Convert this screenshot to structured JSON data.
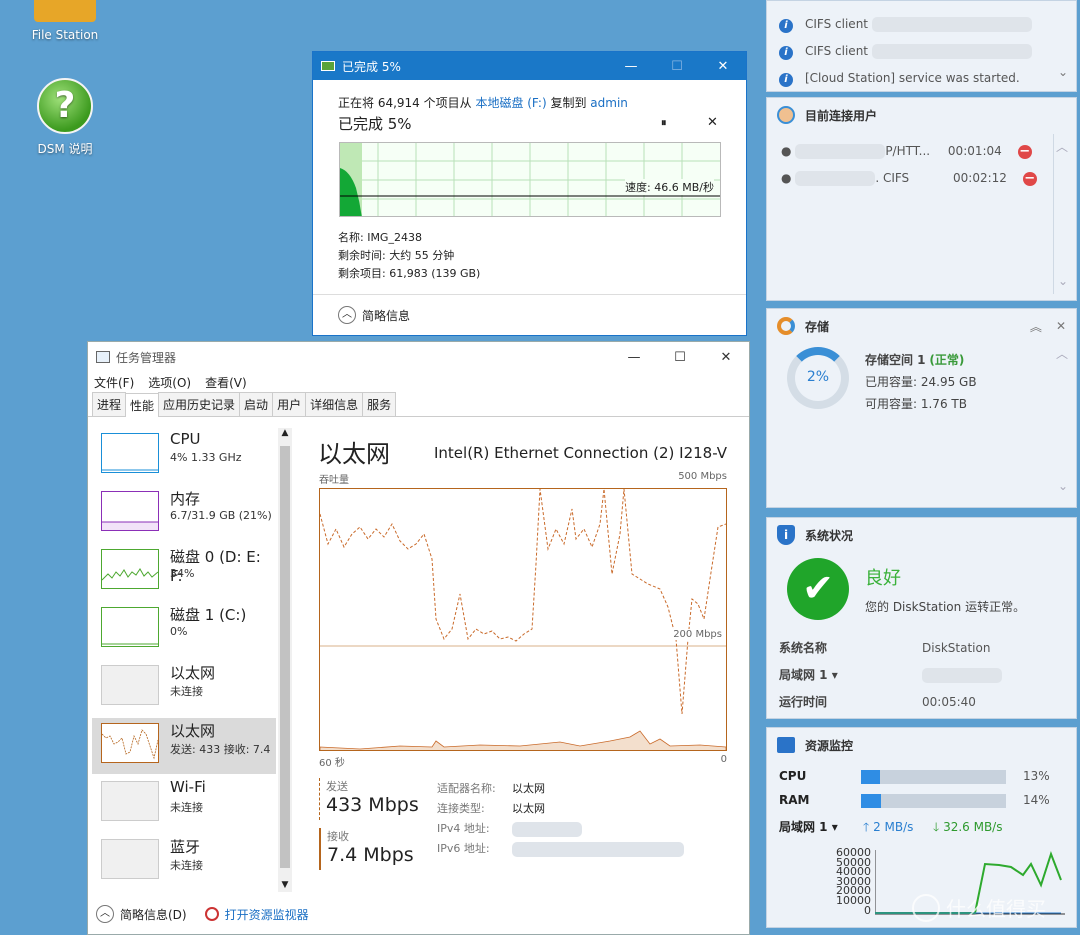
{
  "desktop": {
    "file_station": "File Station",
    "dsm_help": "DSM 说明"
  },
  "copy_dialog": {
    "title": "已完成 5%",
    "line1_prefix": "正在将 64,914 个项目从 ",
    "source": "本地磁盘 (F:)",
    "line1_mid": " 复制到 ",
    "dest": "admin",
    "progress": "已完成 5%",
    "pause": "⏸",
    "close": "✕",
    "speed": "速度: 46.6 MB/秒",
    "name": "名称: IMG_2438",
    "time_left": "剩余时间: 大约 55 分钟",
    "items_left": "剩余项目: 61,983 (139 GB)",
    "details": "简略信息",
    "progress_fraction": 0.05
  },
  "task_manager": {
    "title": "任务管理器",
    "menu": [
      "文件(F)",
      "选项(O)",
      "查看(V)"
    ],
    "tabs": [
      "进程",
      "性能",
      "应用历史记录",
      "启动",
      "用户",
      "详细信息",
      "服务"
    ],
    "side_items": [
      {
        "name": "CPU",
        "sub": "4% 1.33 GHz"
      },
      {
        "name": "内存",
        "sub": "6.7/31.9 GB (21%)"
      },
      {
        "name": "磁盘 0 (D: E: F:",
        "sub": "34%"
      },
      {
        "name": "磁盘 1 (C:)",
        "sub": "0%"
      },
      {
        "name": "以太网",
        "sub": "未连接"
      },
      {
        "name": "以太网",
        "sub": "发送: 433 接收: 7.4"
      },
      {
        "name": "Wi-Fi",
        "sub": "未连接"
      },
      {
        "name": "蓝牙",
        "sub": "未连接"
      }
    ],
    "main_title": "以太网",
    "adapter": "Intel(R) Ethernet Connection (2) I218-V",
    "throughput_label": "吞吐量",
    "max_label": "500 Mbps",
    "mid_label": "200 Mbps",
    "x_left": "60 秒",
    "x_right": "0",
    "send_label": "发送",
    "send_value": "433 Mbps",
    "recv_label": "接收",
    "recv_value": "7.4 Mbps",
    "adapter_name_label": "适配器名称:",
    "adapter_name": "以太网",
    "conn_type_label": "连接类型:",
    "conn_type": "以太网",
    "ipv4_label": "IPv4 地址:",
    "ipv6_label": "IPv6 地址:",
    "footer_details": "简略信息(D)",
    "footer_monitor": "打开资源监视器"
  },
  "notifications": {
    "items": [
      "CIFS client",
      "CIFS client",
      "[Cloud Station] service was started."
    ]
  },
  "users": {
    "title": "目前连接用户",
    "rows": [
      {
        "proto": "P/HTT...",
        "time": "00:01:04"
      },
      {
        "proto": ". CIFS",
        "time": "00:02:12"
      }
    ]
  },
  "storage": {
    "title": "存储",
    "percent": "2%",
    "volume": "存储空间 1",
    "status": "(正常)",
    "used": "已用容量: 24.95 GB",
    "free": "可用容量: 1.76 TB"
  },
  "system": {
    "title": "系统状况",
    "good": "良好",
    "msg": "您的 DiskStation 运转正常。",
    "name_label": "系统名称",
    "name_value": "DiskStation",
    "lan_label": "局域网 1",
    "uptime_label": "运行时间",
    "uptime_value": "00:05:40"
  },
  "monitor": {
    "title": "资源监控",
    "cpu_label": "CPU",
    "cpu_pct": "13%",
    "ram_label": "RAM",
    "ram_pct": "14%",
    "lan_label": "局域网 1",
    "up": "2 MB/s",
    "down": "32.6 MB/s",
    "y_ticks": [
      "60000",
      "50000",
      "40000",
      "30000",
      "20000",
      "10000",
      "0"
    ]
  },
  "watermark": "什么值得买",
  "colors": {
    "accent": "#1a78c8",
    "eth": "#b5651d",
    "ok": "#3ab13a"
  }
}
